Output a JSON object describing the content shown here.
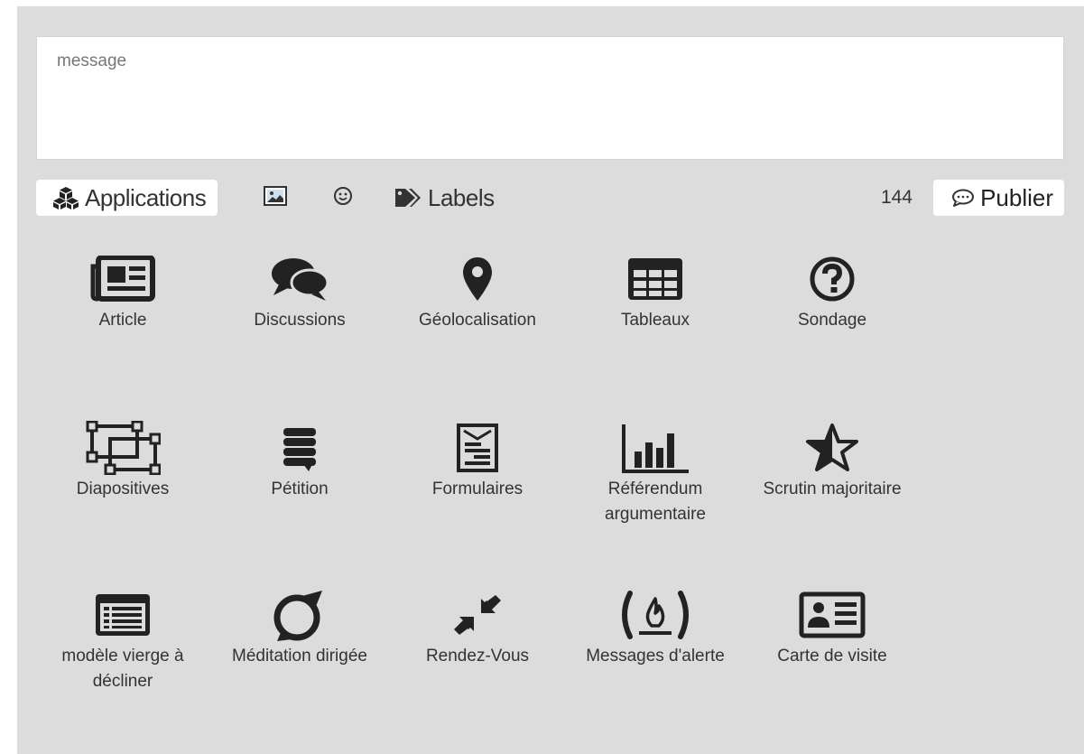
{
  "message": {
    "placeholder": "message"
  },
  "toolbar": {
    "applications_label": "Applications",
    "labels_label": "Labels",
    "char_count": "144",
    "publish_label": "Publier"
  },
  "apps": [
    {
      "label": "Article",
      "icon": "newspaper-icon"
    },
    {
      "label": "Discussions",
      "icon": "comments-icon"
    },
    {
      "label": "Géolocalisation",
      "icon": "map-marker-icon"
    },
    {
      "label": "Tableaux",
      "icon": "table-icon"
    },
    {
      "label": "Sondage",
      "icon": "question-circle-icon"
    },
    {
      "label": "Diapositives",
      "icon": "object-group-icon"
    },
    {
      "label": "Pétition",
      "icon": "petition-icon"
    },
    {
      "label": "Formulaires",
      "icon": "form-icon"
    },
    {
      "label": "Référendum argumentaire",
      "icon": "bar-chart-icon"
    },
    {
      "label": "Scrutin majoritaire",
      "icon": "star-half-icon"
    },
    {
      "label": "modèle vierge à décliner",
      "icon": "list-alt-icon"
    },
    {
      "label": "Méditation dirigée",
      "icon": "meditation-icon"
    },
    {
      "label": "Rendez-Vous",
      "icon": "compress-icon"
    },
    {
      "label": "Messages d'alerte",
      "icon": "fire-alert-icon"
    },
    {
      "label": "Carte de visite",
      "icon": "id-card-icon"
    }
  ]
}
